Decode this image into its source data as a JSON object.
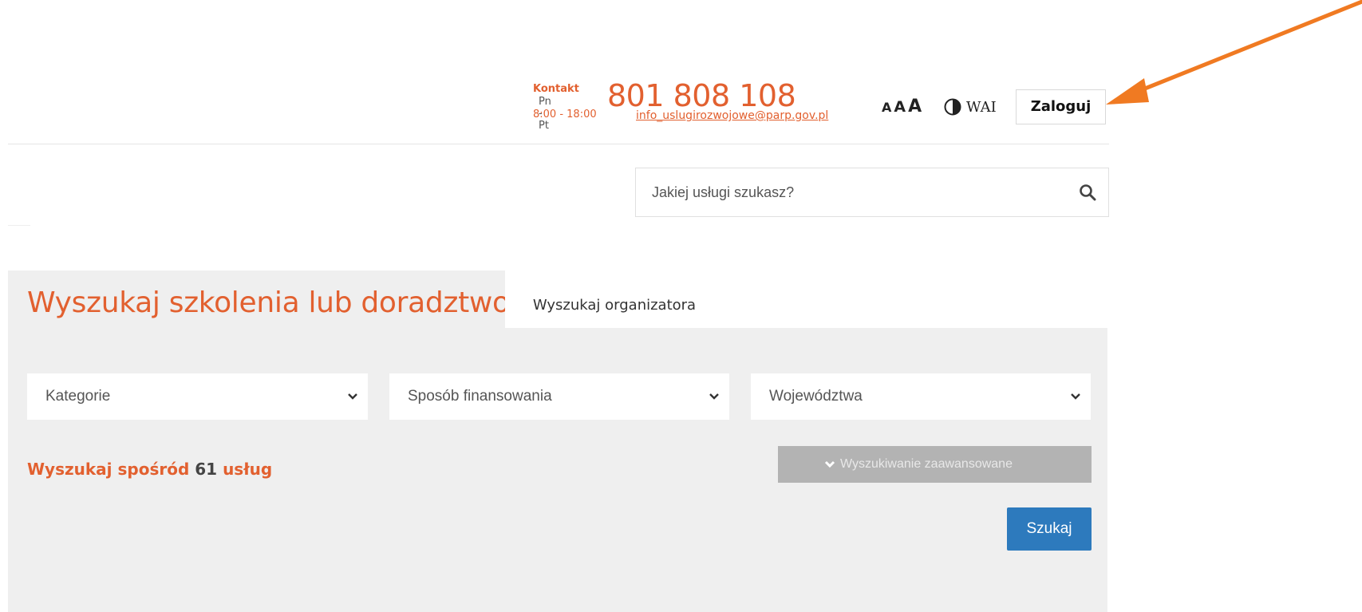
{
  "header": {
    "contact_label": "Kontakt",
    "contact_days": "Pn - Pt",
    "contact_hours": "8:00 - 18:00",
    "phone": "801 808 108",
    "email": "info_uslugirozwojowe@parp.gov.pl",
    "font_size_options": [
      "A",
      "A",
      "A"
    ],
    "contrast_icon": "half-circle-contrast-icon",
    "wai_label": "WAI",
    "login_label": "Zaloguj",
    "annotation_arrow_color": "#f07a22"
  },
  "search": {
    "placeholder": "Jakiej usługi szukasz?",
    "icon": "search-icon"
  },
  "panel": {
    "title": "Wyszukaj szkolenia lub doradztwo",
    "tab_organizer": "Wyszukaj organizatora",
    "filters": [
      {
        "label": "Kategorie"
      },
      {
        "label": "Sposób finansowania"
      },
      {
        "label": "Województwa"
      }
    ],
    "count_prefix": "Wyszukaj spośród",
    "count_value": "61",
    "count_suffix": "usług",
    "advanced_label": "Wyszukiwanie zaawansowane",
    "search_button": "Szukaj"
  },
  "colors": {
    "accent": "#e2602f",
    "panel_bg": "#efefef",
    "primary_button": "#2d7abd",
    "disabled_button": "#b3b3b3"
  }
}
